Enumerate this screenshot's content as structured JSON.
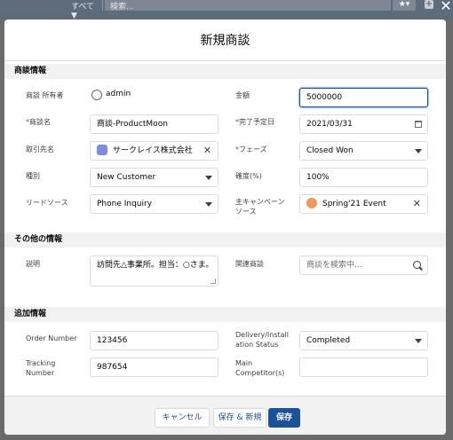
{
  "background": {
    "scope_label": "すべて ▼",
    "search_placeholder": "検索...",
    "star_label": "★▾",
    "plus_label": "+",
    "close_label": "✕"
  },
  "modal": {
    "title": "新規商談",
    "sections": {
      "opportunity_info": "商談情報",
      "other_info": "その他の情報",
      "additional_info": "追加情報"
    },
    "fields": {
      "owner": {
        "label": "商談 所有者",
        "value": "admin"
      },
      "amount": {
        "label": "金額",
        "value": "5000000"
      },
      "opp_name": {
        "label": "商談名",
        "value": "商談-ProductMoon"
      },
      "close_date": {
        "label": "完了予定日",
        "value": "2021/03/31"
      },
      "account": {
        "label": "取引先名",
        "value": "サークレイス株式会社"
      },
      "stage": {
        "label": "フェーズ",
        "value": "Closed Won"
      },
      "type": {
        "label": "種別",
        "value": "New Customer"
      },
      "probability": {
        "label": "確度(%)",
        "value": "100%"
      },
      "lead_source": {
        "label": "リードソース",
        "value": "Phone Inquiry"
      },
      "campaign": {
        "label": "主キャンペーンソース",
        "label_line1": "主キャンペーン",
        "label_line2": "ソース",
        "value": "Spring'21 Event"
      },
      "description": {
        "label": "説明",
        "value": "訪問先△事業所。担当：○さま。"
      },
      "related_opp": {
        "label": "関連商談",
        "placeholder": "商談を検索中..."
      },
      "order_number": {
        "label": "Order Number",
        "value": "123456"
      },
      "delivery_status": {
        "label": "Delivery/Installation Status",
        "label_line1": "Delivery/Install",
        "label_line2": "ation Status",
        "value": "Completed"
      },
      "tracking_number": {
        "label": "Tracking Number",
        "label_line1": "Tracking",
        "label_line2": "Number",
        "value": "987654"
      },
      "main_competitors": {
        "label": "Main Competitor(s)",
        "label_line1": "Main",
        "label_line2": "Competitor(s)",
        "value": ""
      }
    },
    "required_marker": "*",
    "buttons": {
      "cancel": "キャンセル",
      "save_new": "保存 & 新規",
      "save": "保存"
    }
  },
  "colors": {
    "brand": "#1b5297",
    "required": "#c23934",
    "section_bg": "#f3f2f2"
  }
}
